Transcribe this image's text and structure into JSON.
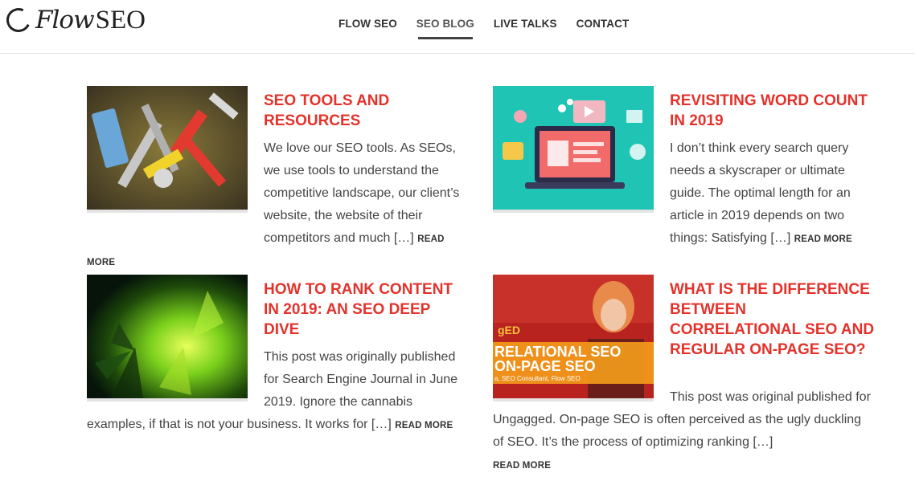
{
  "logo": {
    "text_flow": "Flow",
    "text_seo": "SEO"
  },
  "nav": [
    {
      "label": "FLOW SEO",
      "active": false
    },
    {
      "label": "SEO BLOG",
      "active": true
    },
    {
      "label": "LIVE TALKS",
      "active": false
    },
    {
      "label": "CONTACT",
      "active": false
    }
  ],
  "posts": [
    {
      "title": "SEO TOOLS AND RESOURCES",
      "excerpt": "We love our SEO tools. As SEOs, we use tools to understand the competitive landscape, our client’s website, the website of their competitors and much […]",
      "read_more": "READ MORE",
      "thumb_icon": "tools-image"
    },
    {
      "title": "REVISITING WORD COUNT IN 2019",
      "excerpt": "I don’t think every search query needs a skyscraper or ultimate guide. The optimal length for an article in 2019 depends on two things: Satisfying […]",
      "read_more": "READ MORE",
      "thumb_icon": "laptop-illustration"
    },
    {
      "title": "HOW TO RANK CONTENT IN 2019: AN SEO DEEP DIVE",
      "excerpt": "This post was originally published for Search Engine Journal in June 2019. Ignore the cannabis examples, if that is not your business. It works for […]",
      "read_more": "READ MORE",
      "thumb_icon": "cannabis-leaf-image"
    },
    {
      "title": "WHAT IS THE DIFFERENCE BETWEEN CORRELATIONAL SEO AND REGULAR ON-PAGE SEO?",
      "excerpt": "This post was original published for Ungagged.   On-page SEO is often perceived as the ugly duckling of SEO. It’s the process of optimizing ranking […]",
      "read_more": "READ MORE",
      "thumb_icon": "speaker-image",
      "thumb_text": {
        "line1": "RELATIONAL SEO",
        "line2": "ON-PAGE SEO",
        "line3": "a, SEO Consultant, Flow SEO",
        "tag": "gED"
      }
    }
  ],
  "colors": {
    "title": "#e4322b",
    "text": "#444444",
    "nav": "#333333"
  }
}
